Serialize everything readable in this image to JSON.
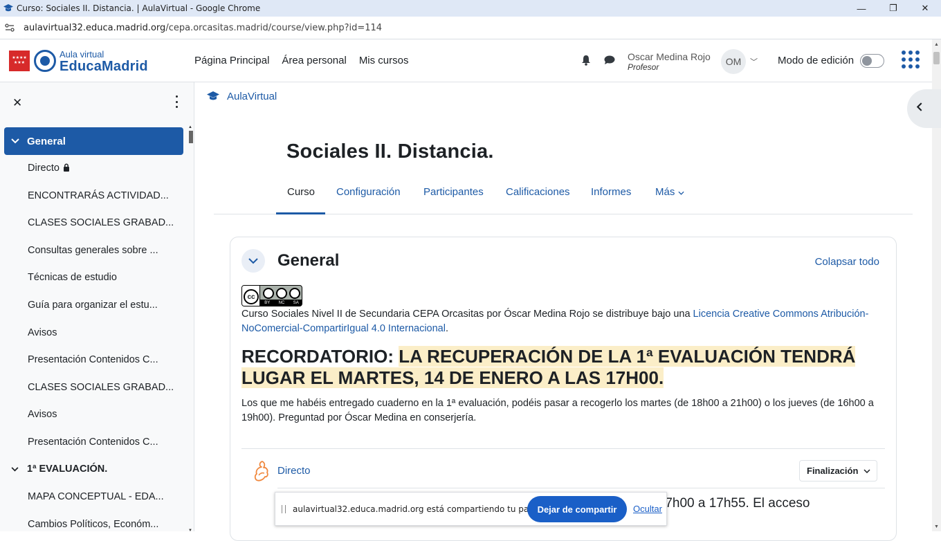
{
  "browser": {
    "window_title": "Curso: Sociales II. Distancia. | AulaVirtual - Google Chrome",
    "url_host": "aulavirtual32.educa.madrid.org",
    "url_path": "/cepa.orcasitas.madrid/course/view.php?id=114",
    "controls": {
      "minimize": "—",
      "restore": "❐",
      "close": "✕"
    }
  },
  "header": {
    "logo_line1": "Aula virtual",
    "logo_line2": "EducaMadrid",
    "logo_stars": "★★★★ ★★★",
    "nav": [
      "Página Principal",
      "Área personal",
      "Mis cursos"
    ],
    "user_name": "Oscar Medina Rojo",
    "user_role": "Profesor",
    "user_initials": "OM",
    "edit_mode_label": "Modo de edición",
    "edit_mode_on": false
  },
  "course_index": {
    "close_glyph": "✕",
    "active_section": "General",
    "items": [
      "Directo",
      "ENCONTRARÁS ACTIVIDAD...",
      "CLASES SOCIALES GRABAD...",
      "Consultas generales sobre ...",
      "Técnicas de estudio",
      "Guía para organizar el estu...",
      "Avisos",
      "Presentación Contenidos C...",
      "CLASES SOCIALES GRABAD...",
      "Avisos",
      "Presentación Contenidos C..."
    ],
    "section_2": "1ª EVALUACIÓN.",
    "section_2_items": [
      "MAPA CONCEPTUAL - EDA...",
      "Cambios Políticos, Económ..."
    ]
  },
  "breadcrumb": {
    "label": "AulaVirtual"
  },
  "course": {
    "title": "Sociales II. Distancia.",
    "tabs": [
      "Curso",
      "Configuración",
      "Participantes",
      "Calificaciones",
      "Informes",
      "Más"
    ],
    "active_tab": "Curso"
  },
  "section": {
    "title": "General",
    "collapse_all": "Colapsar todo",
    "cc_badge": {
      "symbol": "cc",
      "strip": [
        "BY",
        "NC",
        "SA"
      ]
    },
    "license_prefix": "Curso Sociales Nivel II de Secundaria CEPA Orcasitas por Óscar Medina Rojo se distribuye bajo una ",
    "license_link": "Licencia Creative Commons Atribución-NoComercial-CompartirIgual 4.0 Internacional",
    "license_suffix": ".",
    "reminder_lead": "RECORDATORIO: ",
    "reminder_highlight": "LA RECUPERACIÓN DE LA 1ª EVALUACIÓN TENDRÁ LUGAR EL MARTES, 14 DE ENERO A LAS 17H00.",
    "reminder_note": "Los que me habéis entregado cuaderno en la 1ª evaluación, podéis pasar a recogerlo los martes (de 18h00 a 21h00) o los jueves (de 16h00 a 19h00). Preguntad por Óscar Medina en conserjería.",
    "activity": {
      "name": "Directo",
      "completion_label": "Finalización",
      "description_visible": "es de 17h00 a 17h55. El acceso"
    }
  },
  "share_banner": {
    "message": "aulavirtual32.educa.madrid.org está compartiendo tu pantalla.",
    "stop_label": "Dejar de compartir",
    "hide_label": "Ocultar"
  },
  "colors": {
    "brand_blue": "#1d5aa6",
    "highlight": "#fbeec8",
    "madrid_red": "#d72a2a"
  }
}
